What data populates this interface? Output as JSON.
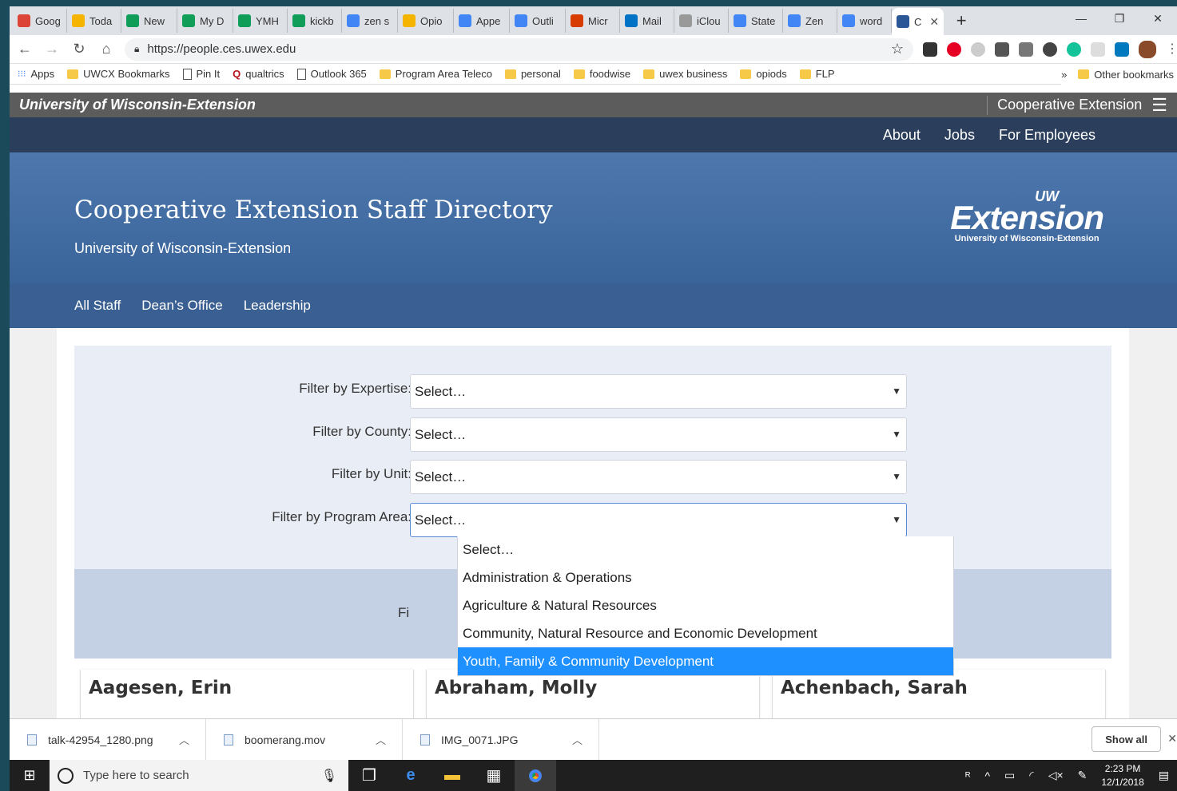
{
  "browser": {
    "tabs": [
      {
        "label": "Goog",
        "color": "#db4437"
      },
      {
        "label": "Toda",
        "color": "#f4b400"
      },
      {
        "label": "New",
        "color": "#0f9d58"
      },
      {
        "label": "My D",
        "color": "#0f9d58"
      },
      {
        "label": "YMH",
        "color": "#0f9d58"
      },
      {
        "label": "kickb",
        "color": "#0f9d58"
      },
      {
        "label": "zen s",
        "color": "#4285f4"
      },
      {
        "label": "Opio",
        "color": "#f4b400"
      },
      {
        "label": "Appe",
        "color": "#4285f4"
      },
      {
        "label": "Outli",
        "color": "#4285f4"
      },
      {
        "label": "Micr",
        "color": "#d83b01"
      },
      {
        "label": "Mail",
        "color": "#0072c6"
      },
      {
        "label": "iClou",
        "color": "#999999"
      },
      {
        "label": "State",
        "color": "#4285f4"
      },
      {
        "label": "Zen",
        "color": "#4285f4"
      },
      {
        "label": "word",
        "color": "#4285f4"
      }
    ],
    "active_tab": {
      "label": "C",
      "close": "✕"
    },
    "new_tab": "+",
    "window_controls": {
      "minimize": "—",
      "restore": "❐",
      "close": "✕"
    },
    "url": "https://people.ces.uwex.edu",
    "bookmarks": [
      {
        "label": "Apps",
        "kind": "apps"
      },
      {
        "label": "UWCX Bookmarks",
        "kind": "folder"
      },
      {
        "label": "Pin It",
        "kind": "page"
      },
      {
        "label": "qualtrics",
        "kind": "q"
      },
      {
        "label": "Outlook 365",
        "kind": "page"
      },
      {
        "label": "Program Area Teleco",
        "kind": "folder"
      },
      {
        "label": "personal",
        "kind": "folder"
      },
      {
        "label": "foodwise",
        "kind": "folder"
      },
      {
        "label": "uwex business",
        "kind": "folder"
      },
      {
        "label": "opiods",
        "kind": "folder"
      },
      {
        "label": "FLP",
        "kind": "folder"
      }
    ],
    "bookmarks_more": "»",
    "other_bookmarks": "Other bookmarks"
  },
  "site": {
    "org_title": "University of Wisconsin-Extension",
    "org_right": "Cooperative Extension",
    "top_nav": [
      "About",
      "Jobs",
      "For Employees"
    ],
    "hero_title": "Cooperative Extension Staff Directory",
    "hero_subtitle": "University of Wisconsin-Extension",
    "logo_uw": "UW",
    "logo_word": "Extension",
    "logo_tag": "University of Wisconsin-Extension",
    "sub_nav": [
      "All Staff",
      "Dean’s Office",
      "Leadership"
    ],
    "filters": [
      {
        "label": "Filter by Expertise:",
        "value": "Select…"
      },
      {
        "label": "Filter by County:",
        "value": "Select…"
      },
      {
        "label": "Filter by Unit:",
        "value": "Select…"
      },
      {
        "label": "Filter by Program Area:",
        "value": "Select…"
      }
    ],
    "find_partial": "Fi",
    "program_area_options": [
      "Select…",
      "Administration & Operations",
      "Agriculture & Natural Resources",
      "Community, Natural Resource and Economic Development",
      "Youth, Family & Community Development"
    ],
    "highlighted_option": "Youth, Family & Community Development",
    "staff_cards": [
      "Aagesen, Erin",
      "Abraham, Molly",
      "Achenbach, Sarah"
    ]
  },
  "downloads": {
    "items": [
      "talk-42954_1280.png",
      "boomerang.mov",
      "IMG_0071.JPG"
    ],
    "show_all": "Show all"
  },
  "taskbar": {
    "search_placeholder": "Type here to search",
    "time": "2:23 PM",
    "date": "12/1/2018"
  }
}
